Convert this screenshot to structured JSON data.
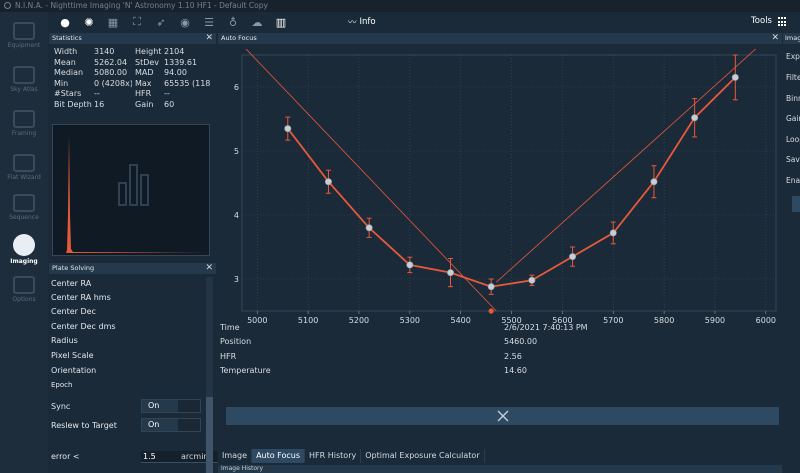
{
  "window": {
    "title": "N.I.N.A. - Nighttime Imaging 'N' Astronomy 1.10 HF1  -  Default Copy"
  },
  "sidebar": {
    "items": [
      {
        "label": "Equipment",
        "active": false
      },
      {
        "label": "Sky Atlas",
        "active": false
      },
      {
        "label": "Framing",
        "active": false
      },
      {
        "label": "Flat Wizard",
        "active": false
      },
      {
        "label": "Sequence",
        "active": false
      },
      {
        "label": "Imaging",
        "active": true
      },
      {
        "label": "Options",
        "active": false
      }
    ]
  },
  "toolbar": {
    "info_label": "Info",
    "tools_label": "Tools",
    "icons": [
      "circle-icon",
      "aperture-icon",
      "grid-icon",
      "expand-icon",
      "pin-icon",
      "target-icon",
      "list-icon",
      "bulb-icon",
      "cloud-icon",
      "bar-chart-icon",
      "line-chart-icon"
    ]
  },
  "statistics": {
    "title": "Statistics",
    "rows": [
      [
        "Width",
        "3140",
        "Height",
        "2104"
      ],
      [
        "Mean",
        "5262.04",
        "StDev",
        "1339.61"
      ],
      [
        "Median",
        "5080.00",
        "MAD",
        "94.00"
      ],
      [
        "Min",
        "0 (4208x)",
        "Max",
        "65535 (118"
      ],
      [
        "#Stars",
        "--",
        "HFR",
        "--"
      ],
      [
        "Bit Depth",
        "16",
        "Gain",
        "60"
      ]
    ]
  },
  "plate_solving": {
    "title": "Plate Solving",
    "fields": [
      "Center RA",
      "Center RA hms",
      "Center Dec",
      "Center Dec dms",
      "Radius",
      "Pixel Scale",
      "Orientation",
      "Epoch"
    ],
    "sync_label": "Sync",
    "sync_value": "On",
    "reslew_label": "Reslew to Target",
    "reslew_value": "On",
    "error_label": "error <",
    "error_value": "1.5",
    "error_unit": "arcmin"
  },
  "autofocus": {
    "title": "Auto Focus",
    "details": [
      {
        "label": "Time",
        "value": "2/6/2021 7:40:13 PM"
      },
      {
        "label": "Position",
        "value": "5460.00"
      },
      {
        "label": "HFR",
        "value": "2.56"
      },
      {
        "label": "Temperature",
        "value": "14.60"
      }
    ],
    "cancel_icon": "x-icon"
  },
  "tabs": [
    "Image",
    "Auto Focus",
    "HFR History",
    "Optimal Exposure Calculator"
  ],
  "active_tab": "Auto Focus",
  "bottom_panel_title": "Image History",
  "image_panel": {
    "title": "Image",
    "rows": [
      "Expo",
      "Filte",
      "Binn",
      "Gain",
      "Loop",
      "Save",
      "Enab"
    ]
  },
  "colors": {
    "background": "#1b2a38",
    "panel_header": "#24394b",
    "accent": "#2e4a63",
    "curve": "#e8593a",
    "points": "#c9ced4"
  },
  "chart_data": {
    "type": "scatter",
    "x": [
      5060,
      5140,
      5220,
      5300,
      5380,
      5460,
      5540,
      5620,
      5700,
      5780,
      5860,
      5940
    ],
    "y": [
      5.35,
      4.52,
      3.8,
      3.22,
      3.1,
      2.88,
      2.98,
      3.35,
      3.72,
      4.52,
      5.52,
      6.15
    ],
    "err": [
      0.18,
      0.18,
      0.15,
      0.12,
      0.22,
      0.12,
      0.08,
      0.15,
      0.17,
      0.25,
      0.3,
      0.35
    ],
    "x_ticks": [
      5000,
      5100,
      5200,
      5300,
      5400,
      5500,
      5600,
      5700,
      5800,
      5900,
      6000
    ],
    "y_ticks": [
      3,
      4,
      5,
      6
    ],
    "xlim": [
      4970,
      6020
    ],
    "ylim": [
      2.5,
      6.5
    ],
    "trend_left": {
      "x": [
        4970,
        5470
      ],
      "y": [
        6.66,
        2.5
      ]
    },
    "trend_right": {
      "x": [
        5470,
        6020
      ],
      "y": [
        2.95,
        6.88
      ]
    },
    "minimum_marker": {
      "x": 5460,
      "y": 2.5
    },
    "grid": true
  }
}
